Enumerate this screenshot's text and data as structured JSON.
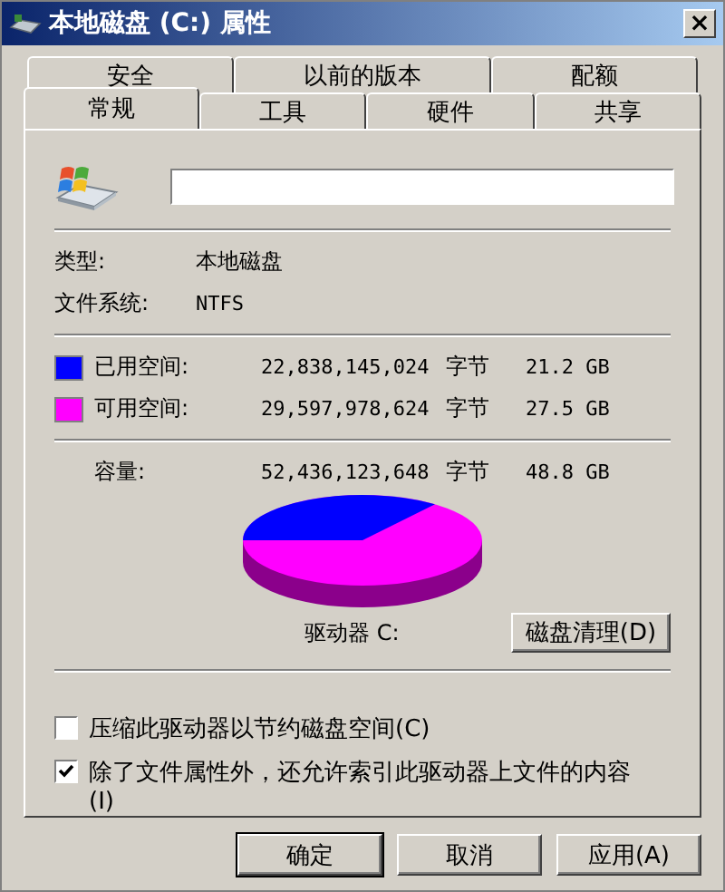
{
  "window": {
    "title": "本地磁盘 (C:) 属性",
    "close": "×"
  },
  "tab_rows": [
    [
      {
        "label": "安全",
        "selected": false
      },
      {
        "label": "以前的版本",
        "selected": false
      },
      {
        "label": "配额",
        "selected": false
      }
    ],
    [
      {
        "label": "常规",
        "selected": true
      },
      {
        "label": "工具",
        "selected": false
      },
      {
        "label": "硬件",
        "selected": false
      },
      {
        "label": "共享",
        "selected": false
      }
    ]
  ],
  "general": {
    "info": [
      {
        "label": "类型:",
        "value": "本地磁盘"
      },
      {
        "label": "文件系统:",
        "value": "NTFS"
      }
    ],
    "space": [
      {
        "label": "已用空间:",
        "color": "#0000ff",
        "bytes": "22,838,145,024",
        "unit": "字节",
        "size": "21.2 GB"
      },
      {
        "label": "可用空间:",
        "color": "#ff00ff",
        "bytes": "29,597,978,624",
        "unit": "字节",
        "size": "27.5 GB"
      }
    ],
    "capacity": {
      "label": "容量:",
      "bytes": "52,436,123,648",
      "unit": "字节",
      "size": "48.8 GB"
    },
    "drive_label": "驱动器 C:",
    "cleanup_button": "磁盘清理(D)",
    "options": [
      {
        "label": "压缩此驱动器以节约磁盘空间(C)",
        "checked": false
      },
      {
        "label": "除了文件属性外，还允许索引此驱动器上文件的内容(I)",
        "checked": true
      }
    ]
  },
  "buttons": [
    "确定",
    "取消",
    "应用(A)"
  ]
}
